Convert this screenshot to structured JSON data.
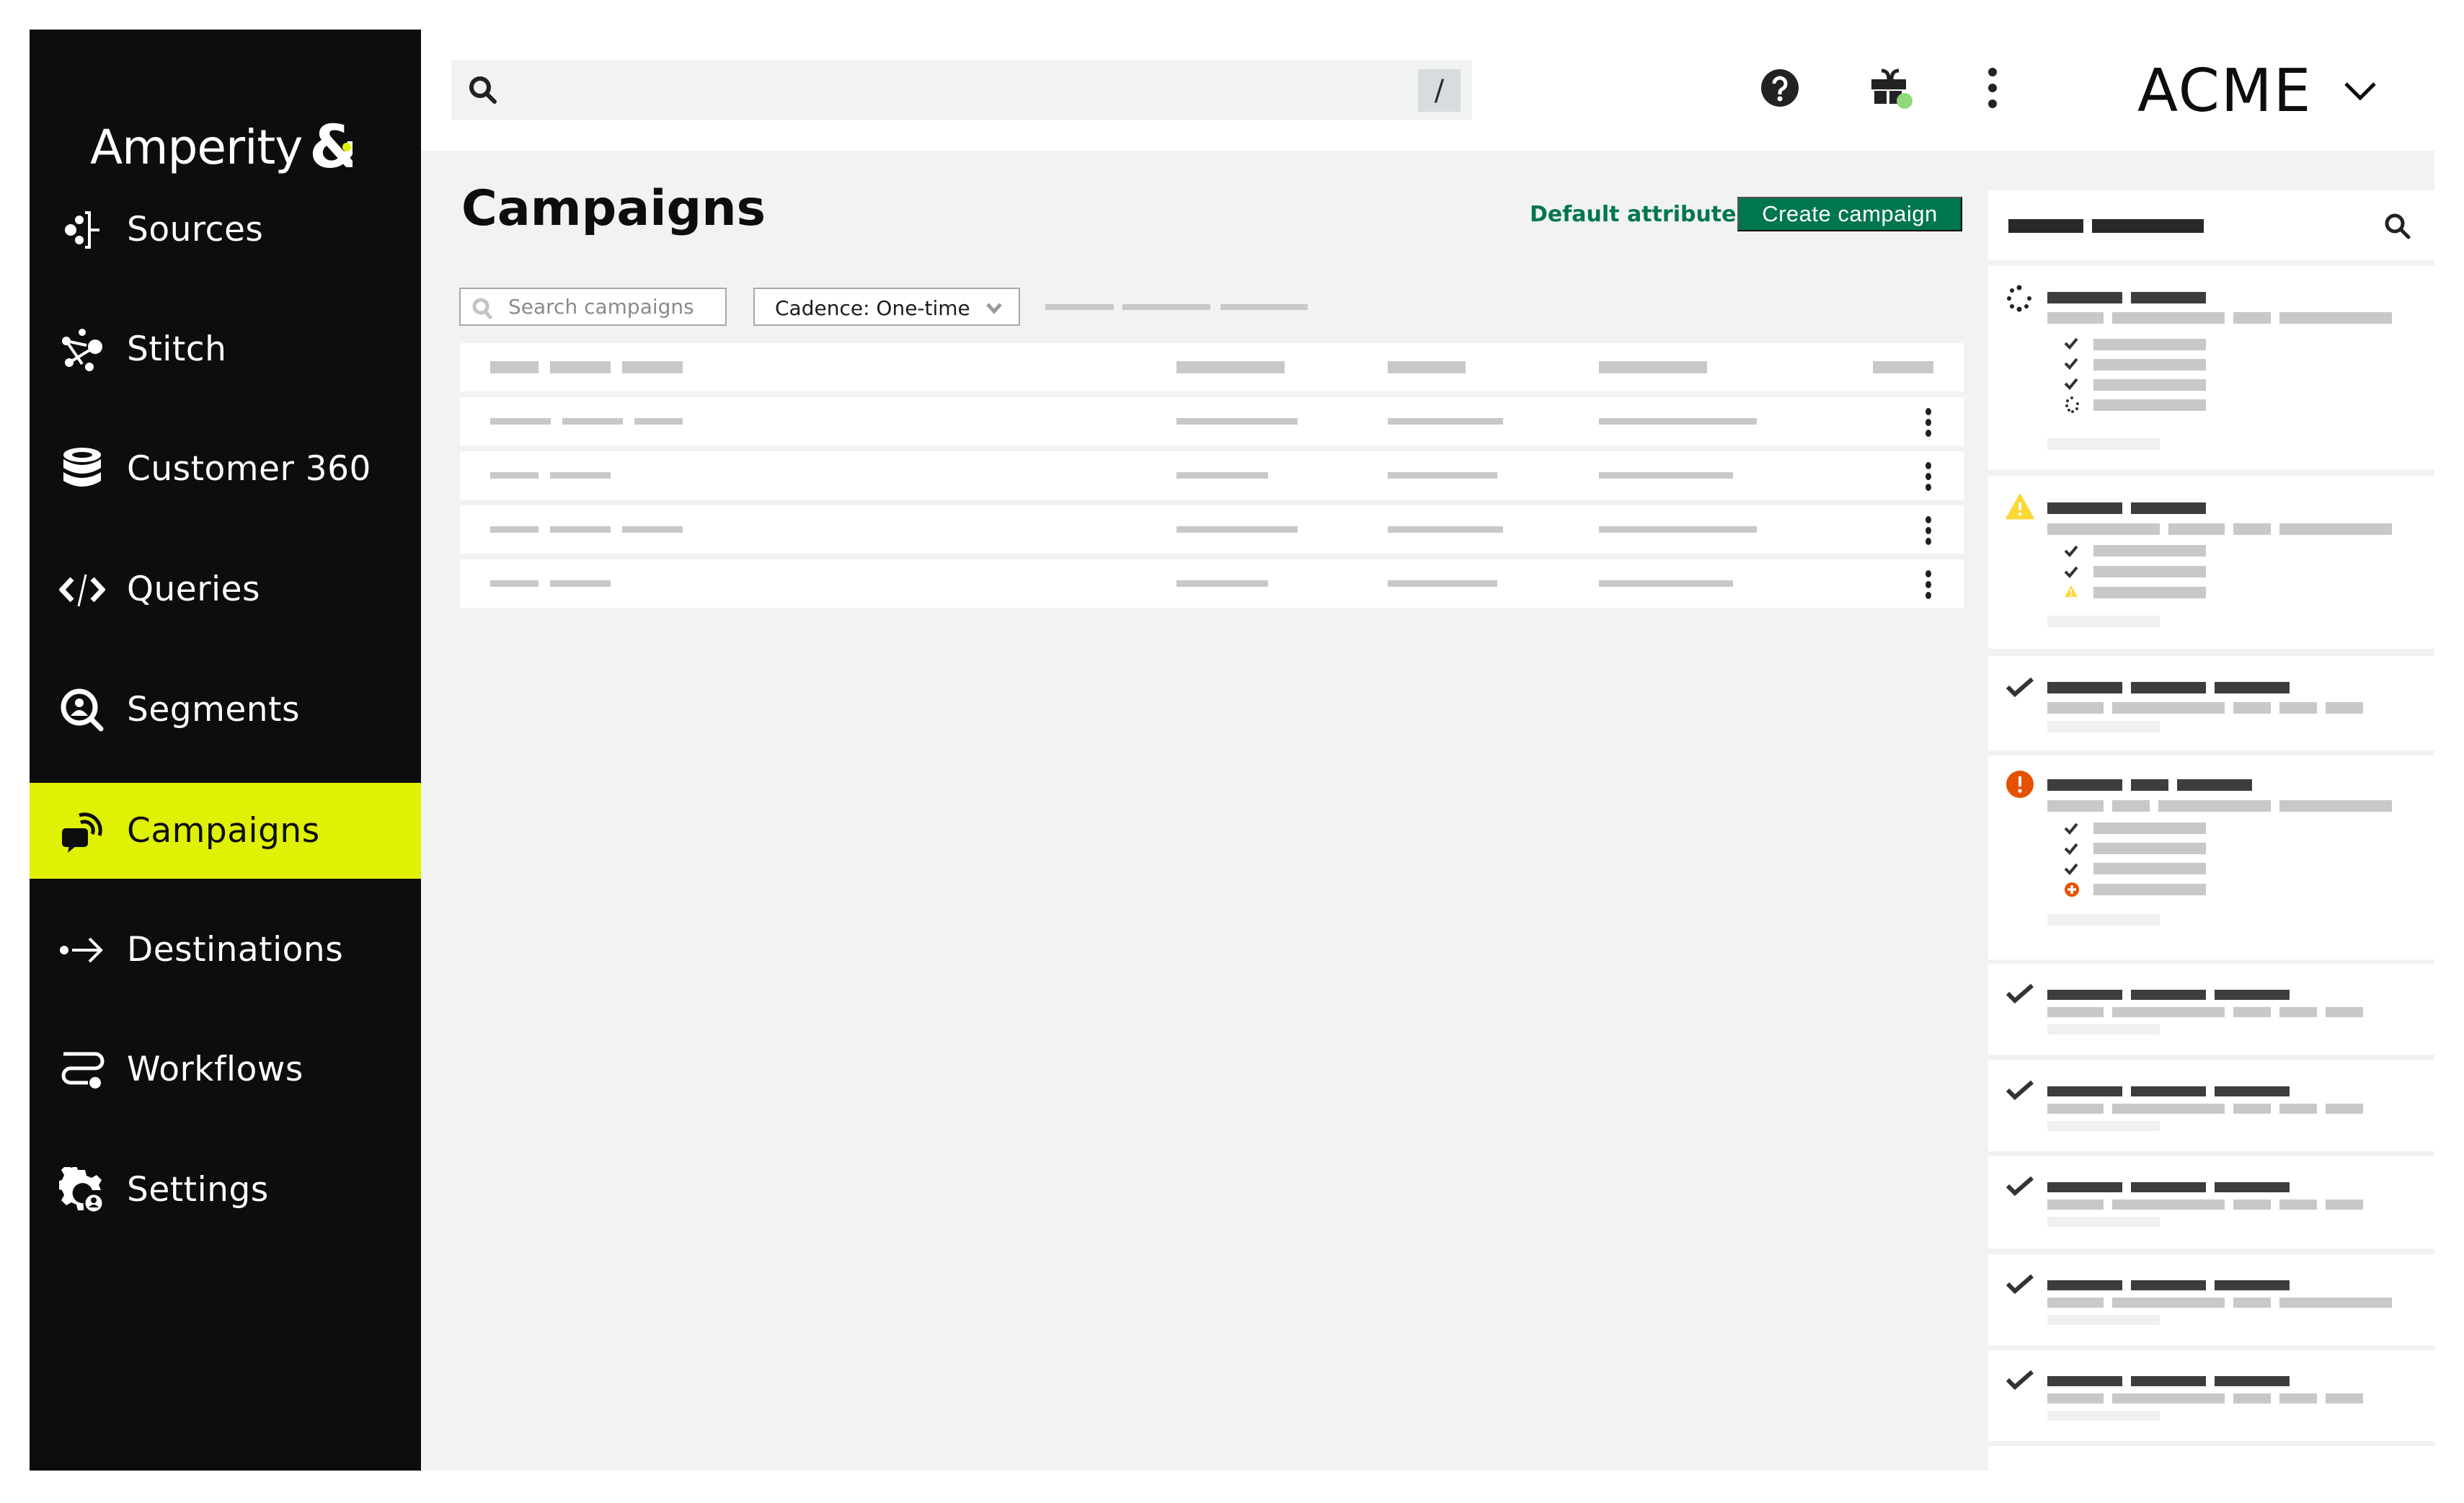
{
  "app": {
    "brand": "Amperity",
    "brand_mark": "&",
    "accent_color": "#dff104",
    "primary_color": "#007650"
  },
  "sidebar": {
    "items": [
      {
        "label": "Sources",
        "icon": "sources-icon",
        "active": false
      },
      {
        "label": "Stitch",
        "icon": "stitch-icon",
        "active": false
      },
      {
        "label": "Customer 360",
        "icon": "database-icon",
        "active": false
      },
      {
        "label": "Queries",
        "icon": "code-icon",
        "active": false
      },
      {
        "label": "Segments",
        "icon": "segment-search-icon",
        "active": false
      },
      {
        "label": "Campaigns",
        "icon": "campaign-icon",
        "active": true
      },
      {
        "label": "Destinations",
        "icon": "arrow-right-icon",
        "active": false
      },
      {
        "label": "Workflows",
        "icon": "workflow-icon",
        "active": false
      },
      {
        "label": "Settings",
        "icon": "settings-gear-icon",
        "active": false
      }
    ]
  },
  "header": {
    "search_placeholder": "",
    "search_shortcut": "/",
    "help_icon": "help-icon",
    "gift_icon": "gift-icon",
    "gift_badge_color": "#8fd97a",
    "more_icon": "more-vertical-icon",
    "tenant_name": "ACME"
  },
  "page": {
    "title": "Campaigns",
    "default_attributes_label": "Default attributes",
    "create_campaign_label": "Create campaign",
    "search_placeholder": "Search campaigns",
    "cadence_filter": "Cadence: One-time"
  },
  "table": {
    "row_count": 4,
    "rows": [
      {
        "status": "placeholder"
      },
      {
        "status": "placeholder"
      },
      {
        "status": "placeholder"
      },
      {
        "status": "placeholder"
      }
    ]
  },
  "activity_panel": {
    "search_icon": "search-icon",
    "cards": [
      {
        "status": "running",
        "steps": [
          "complete",
          "complete",
          "complete",
          "running"
        ]
      },
      {
        "status": "warning",
        "steps": [
          "complete",
          "complete",
          "warning"
        ]
      },
      {
        "status": "complete",
        "steps": []
      },
      {
        "status": "error",
        "steps": [
          "complete",
          "complete",
          "complete",
          "error"
        ]
      },
      {
        "status": "complete",
        "steps": []
      },
      {
        "status": "complete",
        "steps": []
      },
      {
        "status": "complete",
        "steps": []
      },
      {
        "status": "complete",
        "steps": []
      },
      {
        "status": "complete",
        "steps": []
      }
    ],
    "status_colors": {
      "warning": "#fdd835",
      "error": "#e65100",
      "complete": "#3d3d3d"
    }
  }
}
